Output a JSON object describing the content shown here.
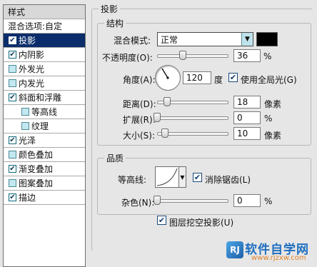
{
  "styles_panel": {
    "header": "样式",
    "blend_options": "混合选项:自定",
    "items": [
      {
        "label": "投影",
        "checked": true
      },
      {
        "label": "内阴影",
        "checked": true
      },
      {
        "label": "外发光",
        "checked": false
      },
      {
        "label": "内发光",
        "checked": false
      },
      {
        "label": "斜面和浮雕",
        "checked": true
      },
      {
        "label": "等高线",
        "checked": false
      },
      {
        "label": "纹理",
        "checked": false
      },
      {
        "label": "光泽",
        "checked": true
      },
      {
        "label": "颜色叠加",
        "checked": false
      },
      {
        "label": "渐变叠加",
        "checked": true
      },
      {
        "label": "图案叠加",
        "checked": false
      },
      {
        "label": "描边",
        "checked": true
      }
    ]
  },
  "drop_shadow": {
    "title": "投影",
    "structure": {
      "title": "结构",
      "blend_mode_label": "混合模式:",
      "blend_mode_value": "正常",
      "shadow_color": "#000000",
      "opacity_label": "不透明度(O):",
      "opacity_value": "36",
      "opacity_unit": "%",
      "opacity_level": 0.36,
      "angle_label": "角度(A):",
      "angle_value": "120",
      "angle_unit": "度",
      "global_light_label": "使用全局光(G)",
      "global_light_checked": true,
      "distance_label": "距离(D):",
      "distance_value": "18",
      "distance_unit": "像素",
      "spread_label": "扩展(R):",
      "spread_value": "0",
      "spread_unit": "%",
      "size_label": "大小(S):",
      "size_value": "10",
      "size_unit": "像素"
    },
    "quality": {
      "title": "品质",
      "contour_label": "等高线:",
      "anti_alias_label": "消除锯齿(L)",
      "anti_alias_checked": true,
      "noise_label": "杂色(N):",
      "noise_value": "0",
      "noise_unit": "%"
    },
    "knockout_label": "图层挖空投影(U)",
    "knockout_checked": true
  },
  "watermark": {
    "icon_text": "RJ",
    "brand": "软件自学网",
    "url": "www.rjzxw.com"
  }
}
